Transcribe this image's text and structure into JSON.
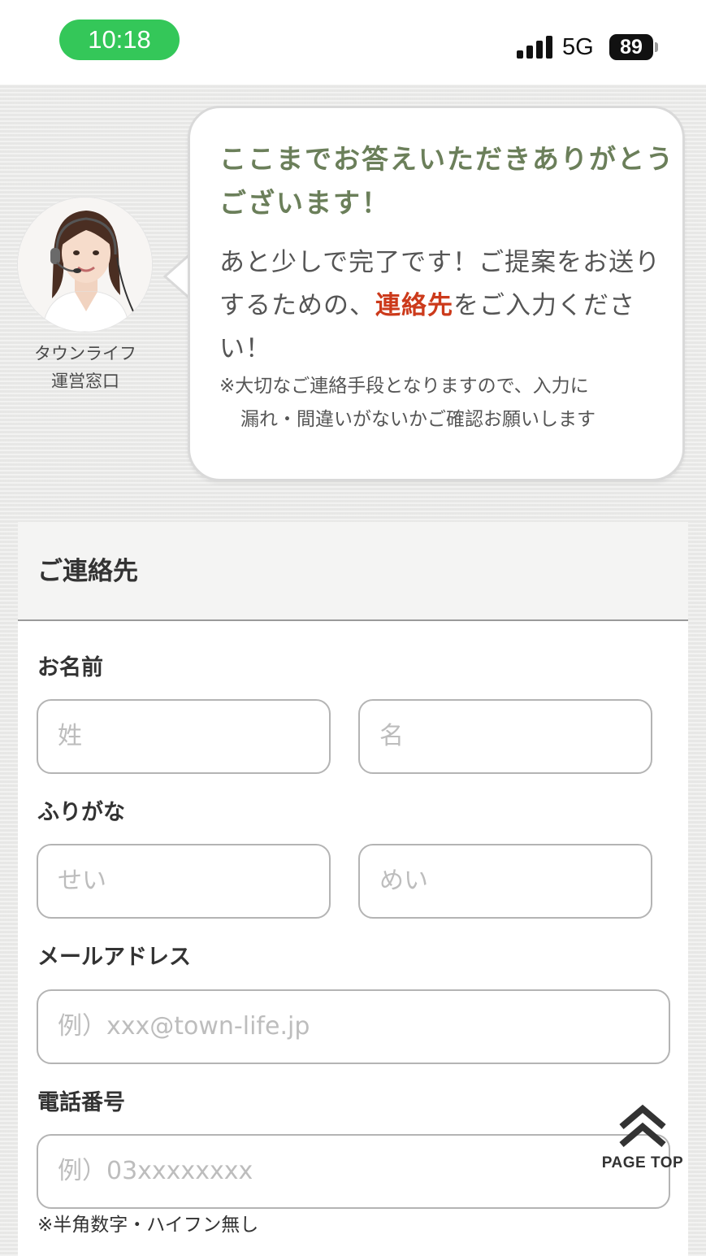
{
  "status_bar": {
    "time": "10:18",
    "network": "5G",
    "battery": "89"
  },
  "operator": {
    "name_line1": "タウンライフ",
    "name_line2": "運営窓口"
  },
  "bubble": {
    "title": "ここまでお答えいただきありがとうございます！",
    "body_before": "あと少しで完了です！ご提案をお送りするための、",
    "body_emphasis": "連絡先",
    "body_after": "をご入力ください！",
    "note_line1": "※大切なご連絡手段となりますので、入力に",
    "note_line2": "漏れ・間違いがないかご確認お願いします"
  },
  "form": {
    "section_title": "ご連絡先",
    "name": {
      "label": "お名前",
      "last_placeholder": "姓",
      "first_placeholder": "名"
    },
    "kana": {
      "label": "ふりがな",
      "last_placeholder": "せい",
      "first_placeholder": "めい"
    },
    "email": {
      "label": "メールアドレス",
      "placeholder": "例）xxx@town-life.jp"
    },
    "phone": {
      "label": "電話番号",
      "placeholder": "例）03xxxxxxxx",
      "hint": "※半角数字・ハイフン無し"
    }
  },
  "page_top": {
    "label": "PAGE TOP",
    "icon": "double-chevron-up-icon"
  },
  "colors": {
    "title_green": "#6b7f5a",
    "emphasis_red": "#cc3a1b",
    "time_pill_green": "#34c759"
  }
}
